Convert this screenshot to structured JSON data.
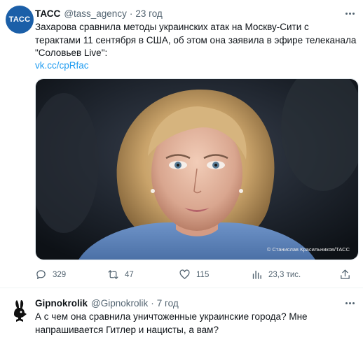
{
  "tweet1": {
    "author_name": "ТАСС",
    "handle": "@tass_agency",
    "separator": "·",
    "time": "23 год",
    "avatar_text": "ТАСС",
    "text_line1": "Захарова сравнила методы украинских атак на Москву-Сити с",
    "text_line2": "терактами 11 сентября в США, об этом она заявила в эфире телеканала",
    "text_line3": "\"Соловьев Live\":",
    "link": "vk.cc/cpRfac",
    "photo_credit": "© Станислав Красильников/ТАСС",
    "reply_count": "329",
    "retweet_count": "47",
    "like_count": "115",
    "views_count": "23,3 тис."
  },
  "tweet2": {
    "author_name": "Gipnokrolik",
    "handle": "@Gipnokrolik",
    "separator": "·",
    "time": "7 год",
    "text_line1": "А с чем она сравнила уничтоженные украинские города? Мне",
    "text_line2": "напрашивается Гитлер и нацисты, а вам?"
  },
  "icons": [
    "more-icon",
    "reply-icon",
    "retweet-icon",
    "like-icon",
    "views-icon",
    "playboy-bunny-icon"
  ],
  "colors": {
    "link": "#1d9bf0",
    "secondary_text": "#536471",
    "tass_blue": "#1b5fa8"
  }
}
